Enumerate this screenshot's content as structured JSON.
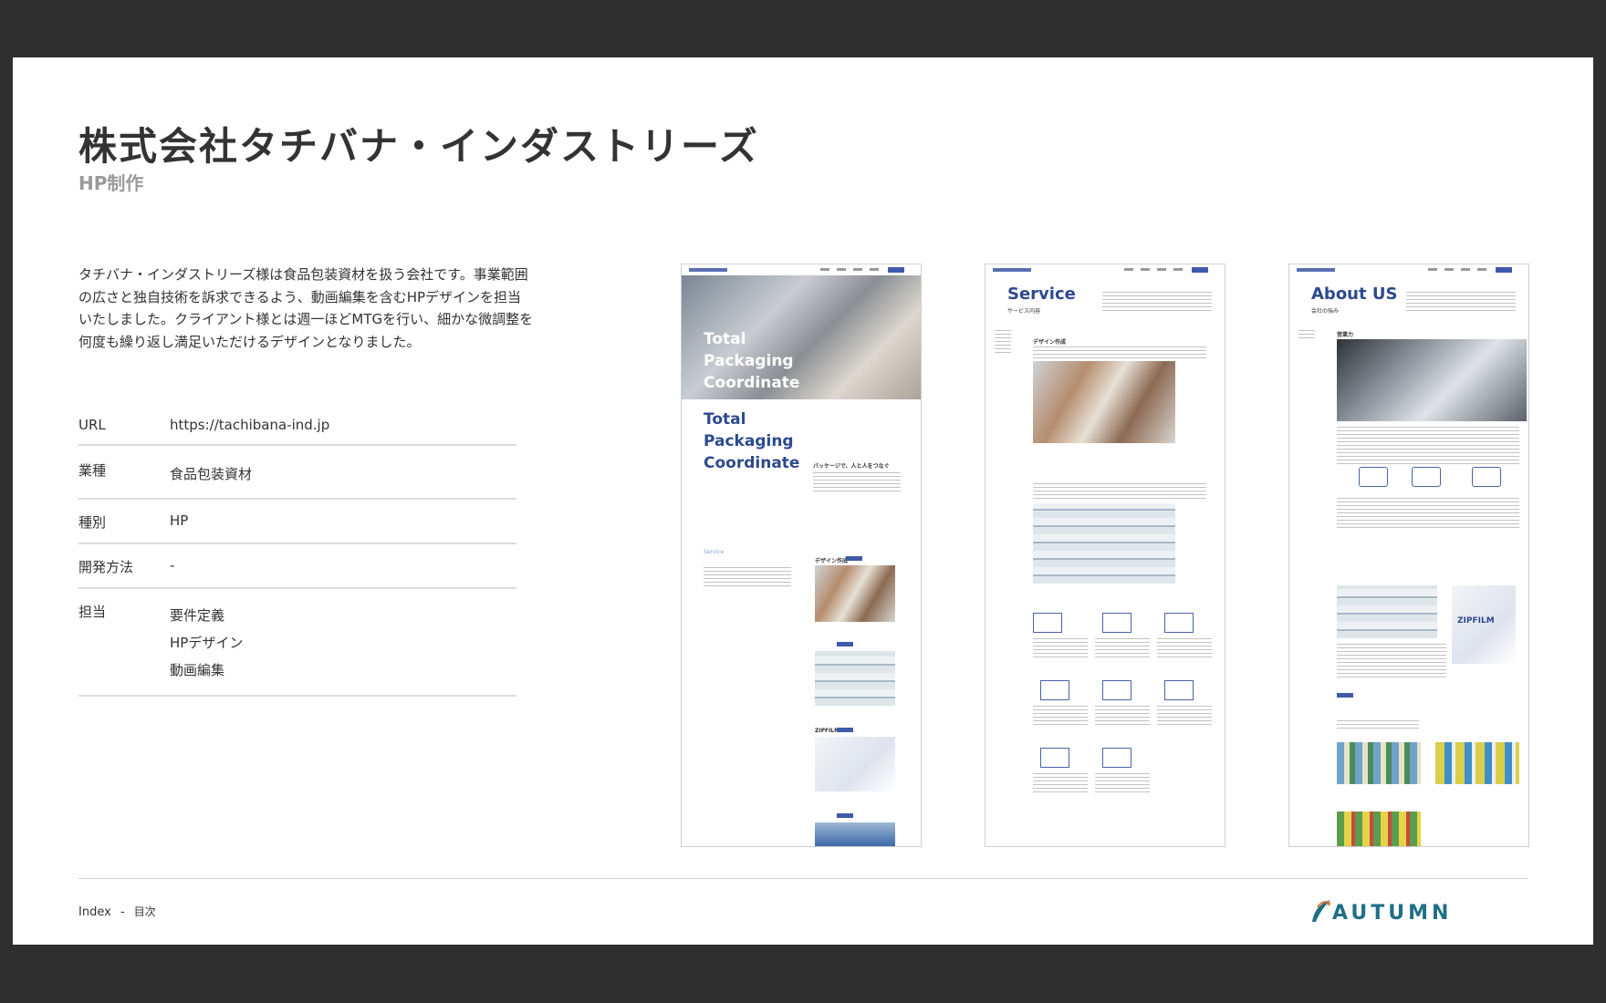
{
  "header": {
    "title": "株式会社タチバナ・インダストリーズ",
    "subtitle": "HP制作"
  },
  "description": "タチバナ・インダストリーズ様は食品包装資材を扱う会社です。事業範囲の広さと独自技術を訴求できるよう、動画編集を含むHPデザインを担当いたしました。クライアント様とは週一ほどMTGを行い、細かな微調整を何度も繰り返し満足いただけるデザインとなりました。",
  "info": {
    "url_label": "URL",
    "url_value": "https://tachibana-ind.jp",
    "industry_label": "業種",
    "industry_value": "食品包装資材",
    "type_label": "種別",
    "type_value": "HP",
    "method_label": "開発方法",
    "method_value": "-",
    "roles_label": "担当",
    "roles": [
      "要件定義",
      "HPデザイン",
      "動画編集"
    ]
  },
  "screenshots": {
    "home": {
      "hero_line1": "Total",
      "hero_line2": "Packaging",
      "hero_line3": "Coordinate",
      "heading_line1": "Total",
      "heading_line2": "Packaging",
      "heading_line3": "Coordinate",
      "tagline": "パッケージで、人と人をつなぐ",
      "service_label": "Service",
      "service_design": "デザイン作成",
      "service_zipfilm": "ZIPFILM"
    },
    "service": {
      "title": "Service",
      "subtitle": "サービス内容",
      "section": "デザイン作成"
    },
    "about": {
      "title": "About US",
      "subtitle": "会社の強み",
      "section": "営業力",
      "badge": "ZIPFILM"
    }
  },
  "footer": {
    "index_label": "Index",
    "separator": "-",
    "toc_label": "目次"
  },
  "brand": {
    "name": "AUTUMN",
    "color": "#1f6f86"
  }
}
